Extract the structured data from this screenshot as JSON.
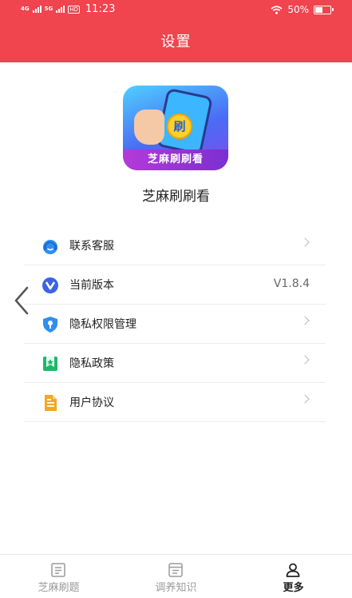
{
  "status_bar": {
    "signal_1": "4G",
    "signal_2": "5G",
    "hd": "HD",
    "time": "11:23",
    "battery_text": "50%",
    "battery_level": 0.5
  },
  "header": {
    "title": "设置"
  },
  "app": {
    "logo_text": "芝麻刷刷看",
    "logo_coin": "刷",
    "name": "芝麻刷刷看"
  },
  "menu": {
    "items": [
      {
        "label": "联系客服",
        "icon": "headset-icon",
        "value": ""
      },
      {
        "label": "当前版本",
        "icon": "version-icon",
        "value": "V1.8.4"
      },
      {
        "label": "隐私权限管理",
        "icon": "shield-key-icon",
        "value": ""
      },
      {
        "label": "隐私政策",
        "icon": "bookmark-star-icon",
        "value": ""
      },
      {
        "label": "用户协议",
        "icon": "document-icon",
        "value": ""
      }
    ]
  },
  "tabbar": {
    "tabs": [
      {
        "label": "芝麻刷题",
        "icon": "doc-list-icon",
        "active": false
      },
      {
        "label": "调养知识",
        "icon": "notebook-icon",
        "active": false
      },
      {
        "label": "更多",
        "icon": "person-icon",
        "active": true
      }
    ]
  },
  "colors": {
    "header": "#f0444f",
    "active_tab": "#222222",
    "inactive_tab": "#9a9a9a"
  }
}
